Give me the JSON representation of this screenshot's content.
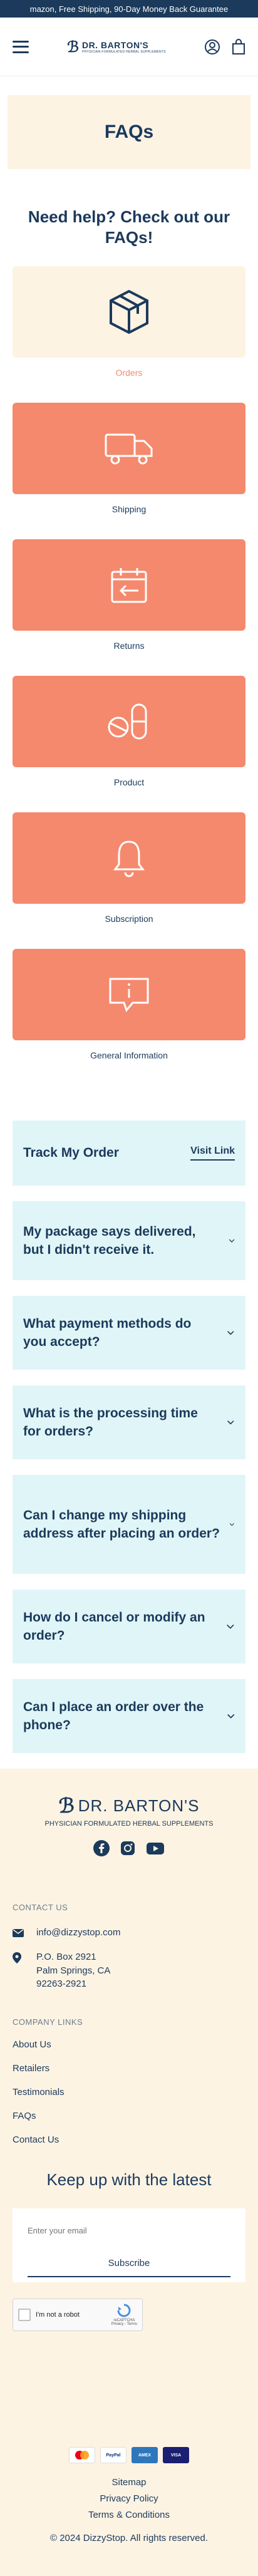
{
  "announcement": "mazon, Free Shipping, 90-Day Money Back Guarantee",
  "brand": {
    "name": "DR. BARTON'S",
    "tagline": "PHYSICIAN FORMULATED HERBAL SUPPLEMENTS"
  },
  "hero": {
    "title": "FAQs"
  },
  "help_heading": "Need help? Check out our FAQs!",
  "categories": [
    {
      "label": "Orders",
      "icon": "box-icon",
      "active": true
    },
    {
      "label": "Shipping",
      "icon": "truck-icon",
      "active": false
    },
    {
      "label": "Returns",
      "icon": "return-calendar-icon",
      "active": false
    },
    {
      "label": "Product",
      "icon": "capsule-icon",
      "active": false
    },
    {
      "label": "Subscription",
      "icon": "bell-icon",
      "active": false
    },
    {
      "label": "General Information",
      "icon": "info-chat-icon",
      "active": false
    }
  ],
  "track": {
    "title": "Track My Order",
    "link": "Visit Link"
  },
  "faqs": [
    "My package says delivered, but I didn't receive it.",
    "What payment methods do you accept?",
    "What is the processing time for orders?",
    "Can I change my shipping address after placing an order?",
    "How do I cancel or modify an order?",
    "Can I place an order over the phone?"
  ],
  "footer": {
    "contact_heading": "CONTACT US",
    "email": "info@dizzystop.com",
    "address_lines": [
      "P.O. Box 2921",
      "Palm Springs, CA",
      "92263-2921"
    ],
    "company_heading": "COMPANY LINKS",
    "company_links": [
      "About Us",
      "Retailers",
      "Testimonials",
      "FAQs",
      "Contact Us"
    ],
    "newsletter_title": "Keep up with the latest",
    "email_placeholder": "Enter your email",
    "subscribe_label": "Subscribe",
    "recaptcha_label": "I'm not a robot",
    "recaptcha_brand": "reCAPTCHA",
    "recaptcha_terms": "Privacy - Terms",
    "payments": [
      {
        "name": "Mastercard",
        "color": "#ffffff"
      },
      {
        "name": "PayPal",
        "color": "#ffffff"
      },
      {
        "name": "AMEX",
        "color": "#2e77bc"
      },
      {
        "name": "VISA",
        "color": "#1a1f71"
      }
    ],
    "bottom_links": [
      "Sitemap",
      "Privacy Policy",
      "Terms & Conditions"
    ],
    "copyright": "© 2024 DizzyStop. All rights reserved."
  },
  "colors": {
    "navy": "#1b3a5c",
    "coral": "#f5896d",
    "cream": "#fdf3e3",
    "mint": "#e0f5f7"
  }
}
